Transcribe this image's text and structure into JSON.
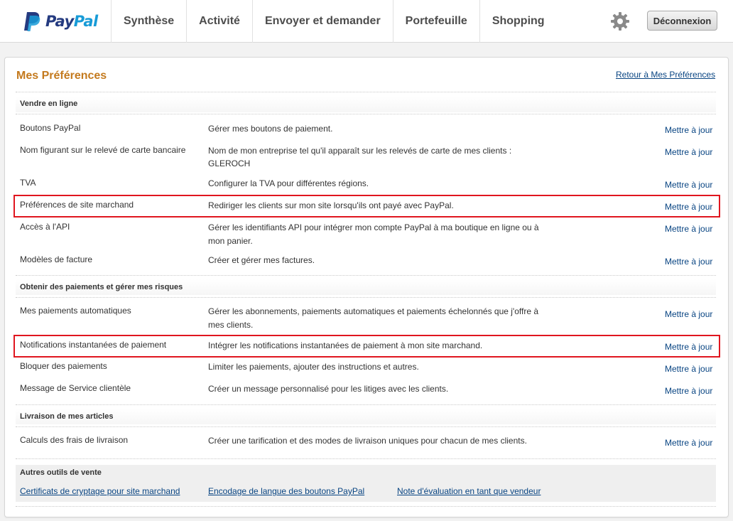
{
  "header": {
    "logo": {
      "pay": "Pay",
      "pal": "Pal"
    },
    "nav": [
      "Synthèse",
      "Activité",
      "Envoyer et demander",
      "Portefeuille",
      "Shopping"
    ],
    "settings_icon": "gear-icon",
    "logout_label": "Déconnexion"
  },
  "page": {
    "title": "Mes Préférences",
    "back_link": "Retour à Mes Préférences"
  },
  "update_label": "Mettre à jour",
  "sections": {
    "sell": {
      "title": "Vendre en ligne",
      "rows": [
        {
          "name": "Boutons PayPal",
          "desc": "Gérer mes boutons de paiement."
        },
        {
          "name": "Nom figurant sur le relevé de carte bancaire",
          "desc": "Nom de mon entreprise tel qu'il apparaît sur les relevés de carte de mes clients :",
          "desc2": "GLEROCH"
        },
        {
          "name": "TVA",
          "desc": "Configurer la TVA pour différentes régions."
        },
        {
          "name": "Préférences de site marchand",
          "desc": "Rediriger les clients sur mon site lorsqu'ils ont payé avec PayPal."
        },
        {
          "name": "Accès à l'API",
          "desc": "Gérer les identifiants API pour intégrer mon compte PayPal à ma boutique en ligne ou à",
          "desc2": "mon panier."
        },
        {
          "name": "Modèles de facture",
          "desc": "Créer et gérer mes factures."
        }
      ]
    },
    "payments": {
      "title": "Obtenir des paiements et gérer mes risques",
      "rows": [
        {
          "name": "Mes paiements automatiques",
          "desc": "Gérer les abonnements, paiements automatiques et paiements échelonnés que j'offre à",
          "desc2": "mes clients."
        },
        {
          "name": "Notifications instantanées de paiement",
          "desc": "Intégrer les notifications instantanées de paiement à mon site marchand."
        },
        {
          "name": "Bloquer des paiements",
          "desc": "Limiter les paiements, ajouter des instructions et autres."
        },
        {
          "name": "Message de Service clientèle",
          "desc": "Créer un message personnalisé pour les litiges avec les clients."
        }
      ]
    },
    "shipping": {
      "title": "Livraison de mes articles",
      "rows": [
        {
          "name": "Calculs des frais de livraison",
          "desc": "Créer une tarification et des modes de livraison uniques pour chacun de mes clients."
        }
      ]
    },
    "tools": {
      "title": "Autres outils de vente",
      "links": [
        "Certificats de cryptage pour site marchand",
        "Encodage de langue des boutons PayPal",
        "Note d'évaluation en tant que vendeur"
      ]
    }
  },
  "colors": {
    "title_orange": "#c47a1e",
    "link_blue": "#084482",
    "highlight_red": "#e0161f",
    "paypal_dark": "#253b80",
    "paypal_light": "#179bd7"
  }
}
